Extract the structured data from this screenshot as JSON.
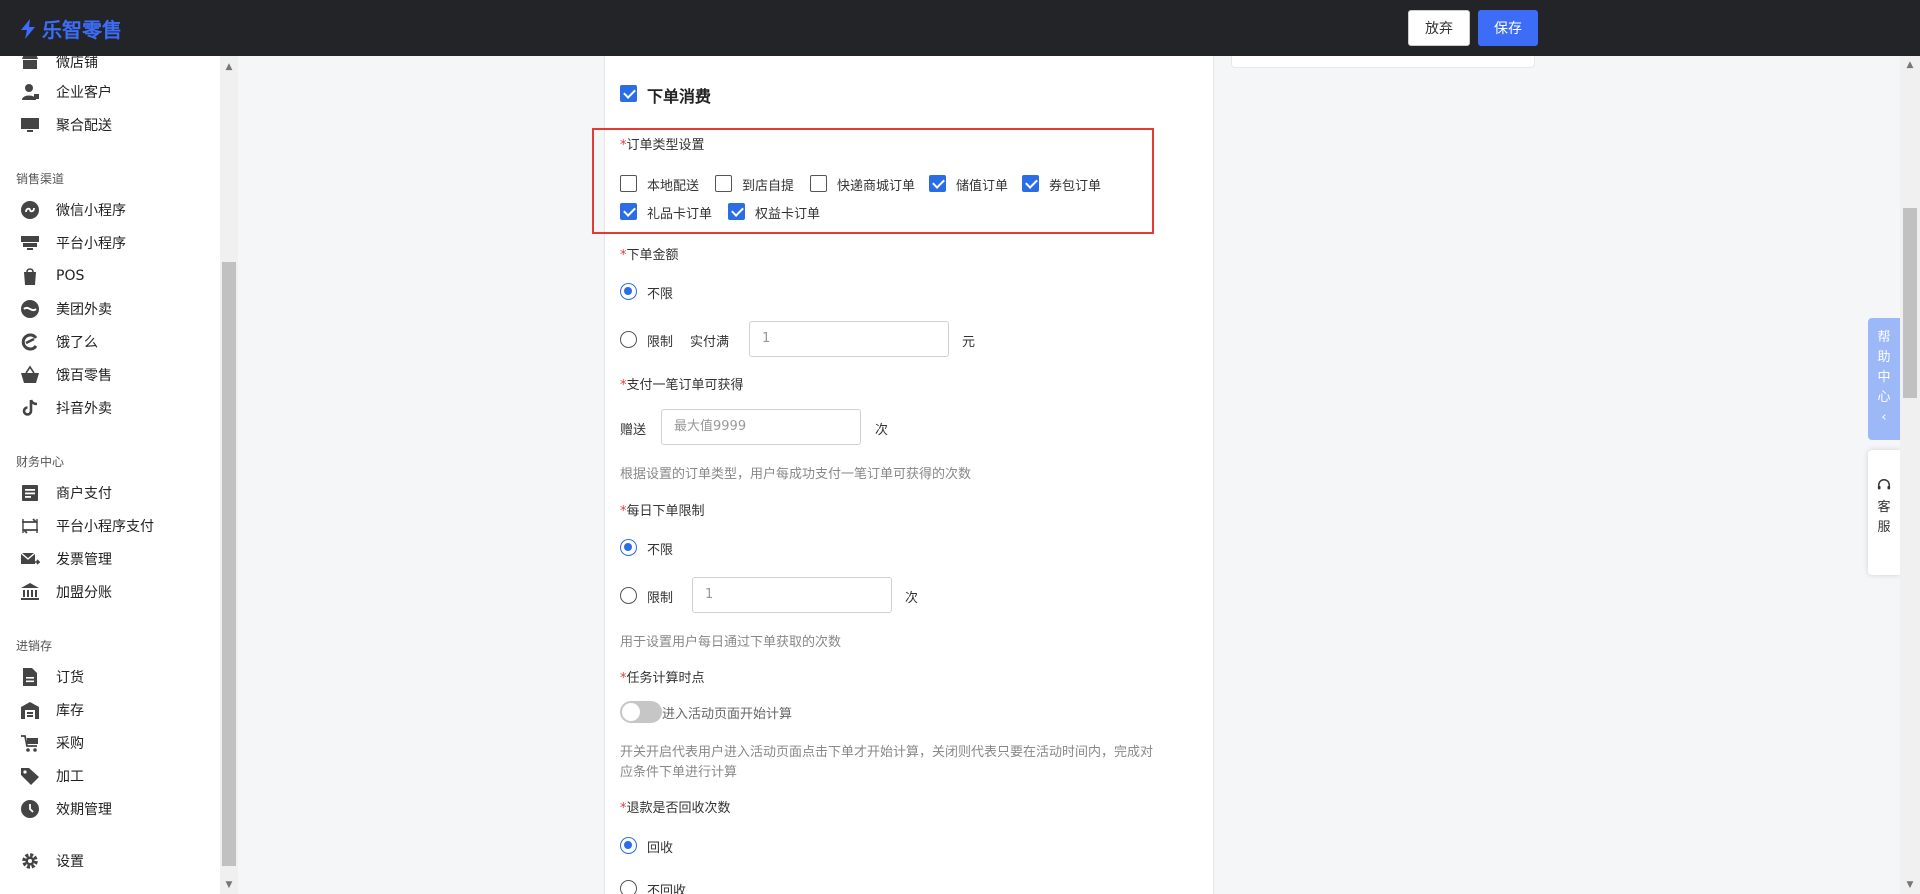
{
  "app": {
    "logo_text": "乐智零售"
  },
  "toolbar": {
    "discard_label": "放弃",
    "save_label": "保存"
  },
  "sidebar": {
    "top_items": [
      {
        "label": "微店铺",
        "icon": "store-icon"
      },
      {
        "label": "企业客户",
        "icon": "person-icon"
      },
      {
        "label": "聚合配送",
        "icon": "monitor-icon"
      }
    ],
    "groups": [
      {
        "title": "销售渠道",
        "items": [
          {
            "label": "微信小程序",
            "icon": "miniprogram-icon"
          },
          {
            "label": "平台小程序",
            "icon": "platform-icon"
          },
          {
            "label": "POS",
            "icon": "pos-bag-icon"
          },
          {
            "label": "美团外卖",
            "icon": "meituan-icon"
          },
          {
            "label": "饿了么",
            "icon": "eleme-icon"
          },
          {
            "label": "饿百零售",
            "icon": "basket-icon"
          },
          {
            "label": "抖音外卖",
            "icon": "tiktok-icon"
          }
        ]
      },
      {
        "title": "财务中心",
        "items": [
          {
            "label": "商户支付",
            "icon": "list-doc-icon"
          },
          {
            "label": "平台小程序支付",
            "icon": "transfer-icon"
          },
          {
            "label": "发票管理",
            "icon": "mail-send-icon"
          },
          {
            "label": "加盟分账",
            "icon": "bank-icon"
          }
        ]
      },
      {
        "title": "进销存",
        "items": [
          {
            "label": "订货",
            "icon": "file-icon"
          },
          {
            "label": "库存",
            "icon": "warehouse-icon"
          },
          {
            "label": "采购",
            "icon": "purchase-icon"
          },
          {
            "label": "加工",
            "icon": "tag-icon"
          },
          {
            "label": "效期管理",
            "icon": "clock-icon"
          }
        ]
      }
    ],
    "settings": {
      "label": "设置",
      "icon": "gear-icon"
    }
  },
  "form": {
    "section_title": "下单消费",
    "section_checked": true,
    "order_type": {
      "label": "订单类型设置",
      "options": [
        {
          "label": "本地配送",
          "checked": false
        },
        {
          "label": "到店自提",
          "checked": false
        },
        {
          "label": "快递商城订单",
          "checked": false
        },
        {
          "label": "储值订单",
          "checked": true
        },
        {
          "label": "券包订单",
          "checked": true
        },
        {
          "label": "礼品卡订单",
          "checked": true
        },
        {
          "label": "权益卡订单",
          "checked": true
        }
      ]
    },
    "order_amount": {
      "label": "下单金额",
      "unlimited_label": "不限",
      "limit_label": "限制",
      "paid_full_label": "实付满",
      "input_placeholder": "1",
      "unit": "元",
      "selected": "unlimited"
    },
    "per_order": {
      "label": "支付一笔订单可获得",
      "gift_label": "赠送",
      "input_placeholder": "最大值9999",
      "unit": "次",
      "hint": "根据设置的订单类型，用户每成功支付一笔订单可获得的次数"
    },
    "daily_limit": {
      "label": "每日下单限制",
      "unlimited_label": "不限",
      "limit_label": "限制",
      "input_placeholder": "1",
      "unit": "次",
      "hint": "用于设置用户每日通过下单获取的次数",
      "selected": "unlimited"
    },
    "task_timing": {
      "label": "任务计算时点",
      "toggle_label": "进入活动页面开始计算",
      "toggle_on": false,
      "hint_line1": "开关开启代表用户进入活动页面点击下单才开始计算，关闭则代表只要在活动时间内，完成对",
      "hint_line2": "应条件下单进行计算"
    },
    "refund": {
      "label": "退款是否回收次数",
      "recycle_label": "回收",
      "no_recycle_label": "不回收",
      "selected": "recycle"
    }
  },
  "float": {
    "help_chars": [
      "帮",
      "助",
      "中",
      "心"
    ],
    "service_chars": [
      "客",
      "服"
    ]
  },
  "colors": {
    "accent": "#3d6cf7",
    "topbar": "#222428",
    "highlight": "#e53935"
  }
}
